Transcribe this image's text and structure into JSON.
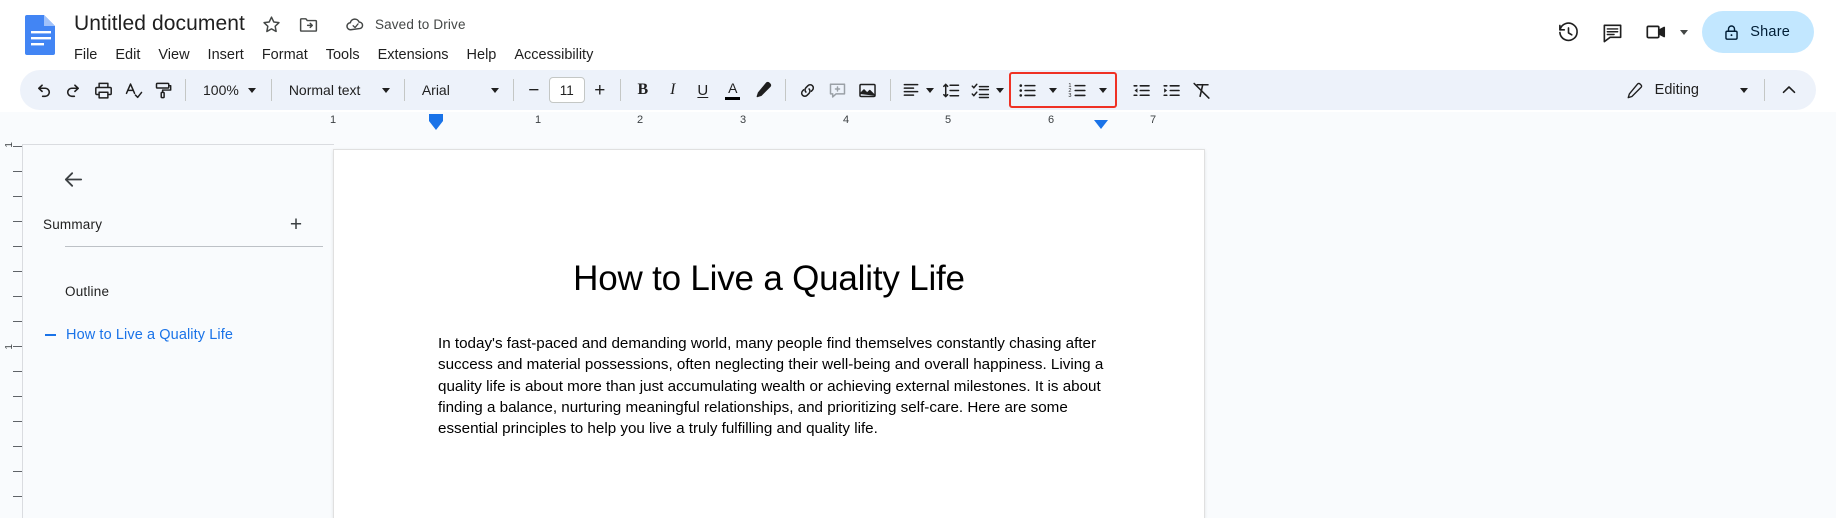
{
  "header": {
    "doc_title": "Untitled document",
    "save_status": "Saved to Drive",
    "icons": {
      "docs_logo": "google-docs-logo",
      "star": "star-icon",
      "move": "move-to-folder-icon",
      "cloud": "cloud-saved-icon",
      "history": "version-history-icon",
      "comments": "comments-icon",
      "meet": "meet-camera-icon",
      "lock": "lock-icon"
    },
    "menus": [
      "File",
      "Edit",
      "View",
      "Insert",
      "Format",
      "Tools",
      "Extensions",
      "Help",
      "Accessibility"
    ],
    "share_label": "Share",
    "share_bg": "#c2e7ff"
  },
  "toolbar": {
    "undo": "undo-icon",
    "redo": "redo-icon",
    "print": "print-icon",
    "spellcheck": "spellcheck-icon",
    "paint_format": "paint-format-icon",
    "zoom_value": "100%",
    "style_value": "Normal text",
    "font_value": "Arial",
    "font_size_value": "11",
    "font_size_decrease": "−",
    "font_size_increase": "+",
    "bold": "B",
    "italic": "I",
    "underline": "U",
    "text_color": "A",
    "highlight_color": "highlight-pen-icon",
    "insert_link": "link-icon",
    "add_comment": "add-comment-icon",
    "insert_image": "insert-image-icon",
    "align": "align-left-icon",
    "line_spacing": "line-spacing-icon",
    "checklist": "checklist-icon",
    "bulleted_list": "bulleted-list-icon",
    "numbered_list": "numbered-list-icon",
    "decrease_indent": "decrease-indent-icon",
    "increase_indent": "increase-indent-icon",
    "clear_formatting": "clear-formatting-icon",
    "editing_mode": "Editing",
    "editing_pencil": "pencil-icon",
    "collapse_toolbar": "chevron-up-icon",
    "highlight_color_box": "#ef3124"
  },
  "ruler": {
    "numbers": [
      "1",
      "1",
      "2",
      "3",
      "4",
      "5",
      "6",
      "7"
    ],
    "left_indent_marker": "left-indent-marker",
    "right_indent_marker": "right-indent-marker"
  },
  "sidebar": {
    "back": "back-arrow-icon",
    "summary_label": "Summary",
    "add_summary": "+",
    "outline_label": "Outline",
    "outline_items": [
      {
        "label": "How to Live a Quality Life",
        "color": "#1a73e8"
      }
    ]
  },
  "document": {
    "heading": "How to Live a Quality Life",
    "paragraph": "In today's fast-paced and demanding world, many people find themselves constantly chasing after success and material possessions, often neglecting their well-being and overall happiness. Living a quality life is about more than just accumulating wealth or achieving external milestones. It is about finding a balance, nurturing meaningful relationships, and prioritizing self-care. Here are some essential principles to help you live a truly fulfilling and quality life."
  }
}
